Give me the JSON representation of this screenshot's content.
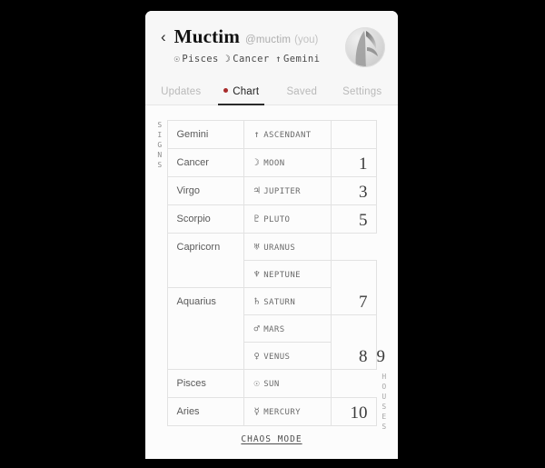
{
  "header": {
    "back_icon": "chevron-left-icon",
    "display_name": "Muctim",
    "handle": "@muctim",
    "you_tag": "(you)",
    "sun_glyph": "☉",
    "sun_sign": "Pisces",
    "moon_glyph": "☽",
    "moon_sign": "Cancer",
    "rising_glyph": "↑",
    "rising_sign": "Gemini",
    "avatar_name": "avatar"
  },
  "tabs": [
    {
      "label": "Updates",
      "active": false
    },
    {
      "label": "Chart",
      "active": true
    },
    {
      "label": "Saved",
      "active": false
    },
    {
      "label": "Settings",
      "active": false
    }
  ],
  "accent_color": "#a82b2b",
  "chart": {
    "left_label": "SIGNS",
    "right_label": "HOUSES",
    "rows": [
      {
        "sign": "Gemini",
        "sign_span": 1,
        "glyph": "↑",
        "planet": "ASCENDANT",
        "house": "",
        "house_span": 1
      },
      {
        "sign": "Cancer",
        "sign_span": 1,
        "glyph": "☽",
        "planet": "MOON",
        "house": "1",
        "house_span": 1
      },
      {
        "sign": "Virgo",
        "sign_span": 1,
        "glyph": "♃",
        "planet": "JUPITER",
        "house": "3",
        "house_span": 1
      },
      {
        "sign": "Scorpio",
        "sign_span": 1,
        "glyph": "♇",
        "planet": "PLUTO",
        "house": "5",
        "house_span": 1
      },
      {
        "sign": "Capricorn",
        "sign_span": 2,
        "glyph": "♅",
        "planet": "URANUS",
        "house": "",
        "house_span": 0
      },
      {
        "sign": "",
        "sign_span": 0,
        "glyph": "♆",
        "planet": "NEPTUNE",
        "house": "7",
        "house_span": 2
      },
      {
        "sign": "Aquarius",
        "sign_span": 3,
        "glyph": "♄",
        "planet": "SATURN",
        "house": "",
        "house_span": 0
      },
      {
        "sign": "",
        "sign_span": 0,
        "glyph": "♂",
        "planet": "MARS",
        "house": "8",
        "house_span": 2
      },
      {
        "sign": "",
        "sign_span": 0,
        "glyph": "♀",
        "planet": "VENUS",
        "house": "9",
        "house_span": 1
      },
      {
        "sign": "Pisces",
        "sign_span": 1,
        "glyph": "☉",
        "planet": "SUN",
        "house": "",
        "house_span": 0
      },
      {
        "sign": "Aries",
        "sign_span": 1,
        "glyph": "☿",
        "planet": "MERCURY",
        "house": "10",
        "house_span": 2
      }
    ]
  },
  "footer": {
    "chaos_mode": "CHAOS MODE"
  }
}
